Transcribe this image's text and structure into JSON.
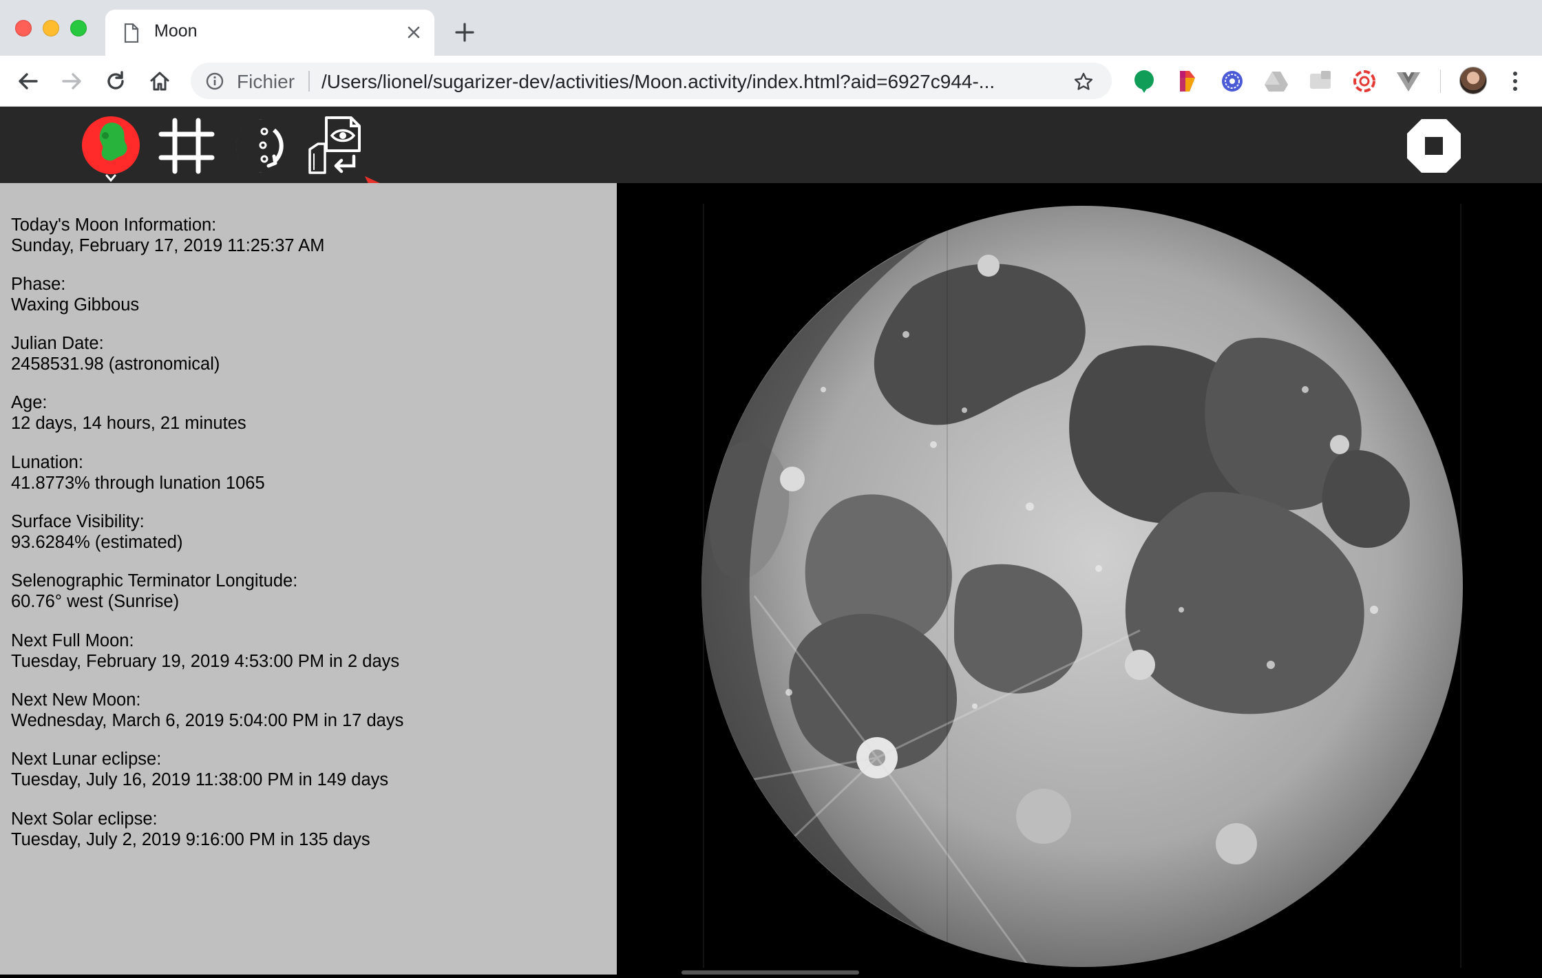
{
  "browser": {
    "tab_title": "Moon",
    "address": {
      "scheme_label": "Fichier",
      "url": "/Users/lionel/sugarizer-dev/activities/Moon.activity/index.html?aid=6927c944-..."
    },
    "icons": [
      "back-arrow-icon",
      "forward-arrow-icon",
      "reload-icon",
      "home-icon",
      "info-icon",
      "star-icon",
      "close-icon",
      "plus-icon",
      "kebab-menu-icon"
    ],
    "extensions": [
      "green-bubble-extension",
      "colorful-extension",
      "globe-extension",
      "drive-extension",
      "cast-extension",
      "red-swirl-extension",
      "vue-extension"
    ]
  },
  "sugar_toolbar": {
    "buttons": [
      "activity-icon",
      "grid-icon",
      "moon-flip-icon",
      "export-view-icon",
      "stop-icon"
    ],
    "activity_colors": {
      "fill": "#28b43c",
      "stroke": "#ff2b2b"
    }
  },
  "moon_info": {
    "heading": {
      "label": "Today's Moon Information:",
      "value": "Sunday, February 17, 2019 11:25:37 AM"
    },
    "phase": {
      "label": "Phase:",
      "value": "Waxing Gibbous"
    },
    "julian": {
      "label": "Julian Date:",
      "value": "2458531.98 (astronomical)"
    },
    "age": {
      "label": "Age:",
      "value": "12 days, 14 hours, 21 minutes"
    },
    "lunation": {
      "label": "Lunation:",
      "value": "41.8773% through lunation 1065"
    },
    "visibility": {
      "label": "Surface Visibility:",
      "value": "93.6284% (estimated)"
    },
    "terminator": {
      "label": "Selenographic Terminator Longitude:",
      "value": "60.76° west (Sunrise)"
    },
    "full_moon": {
      "label": "Next Full Moon:",
      "value": "Tuesday, February 19, 2019 4:53:00 PM in 2 days"
    },
    "new_moon": {
      "label": "Next New Moon:",
      "value": "Wednesday, March 6, 2019 5:04:00 PM in 17 days"
    },
    "lunar_eclipse": {
      "label": "Next Lunar eclipse:",
      "value": "Tuesday, July 16, 2019 11:38:00 PM in 149 days"
    },
    "solar_eclipse": {
      "label": "Next Solar eclipse:",
      "value": "Tuesday, July 2, 2019 9:16:00 PM in 135 days"
    }
  },
  "colors": {
    "sugar_toolbar_bg": "#282828",
    "info_panel_bg": "#c0c0c0",
    "annotation_arrow": "#e8312a"
  }
}
